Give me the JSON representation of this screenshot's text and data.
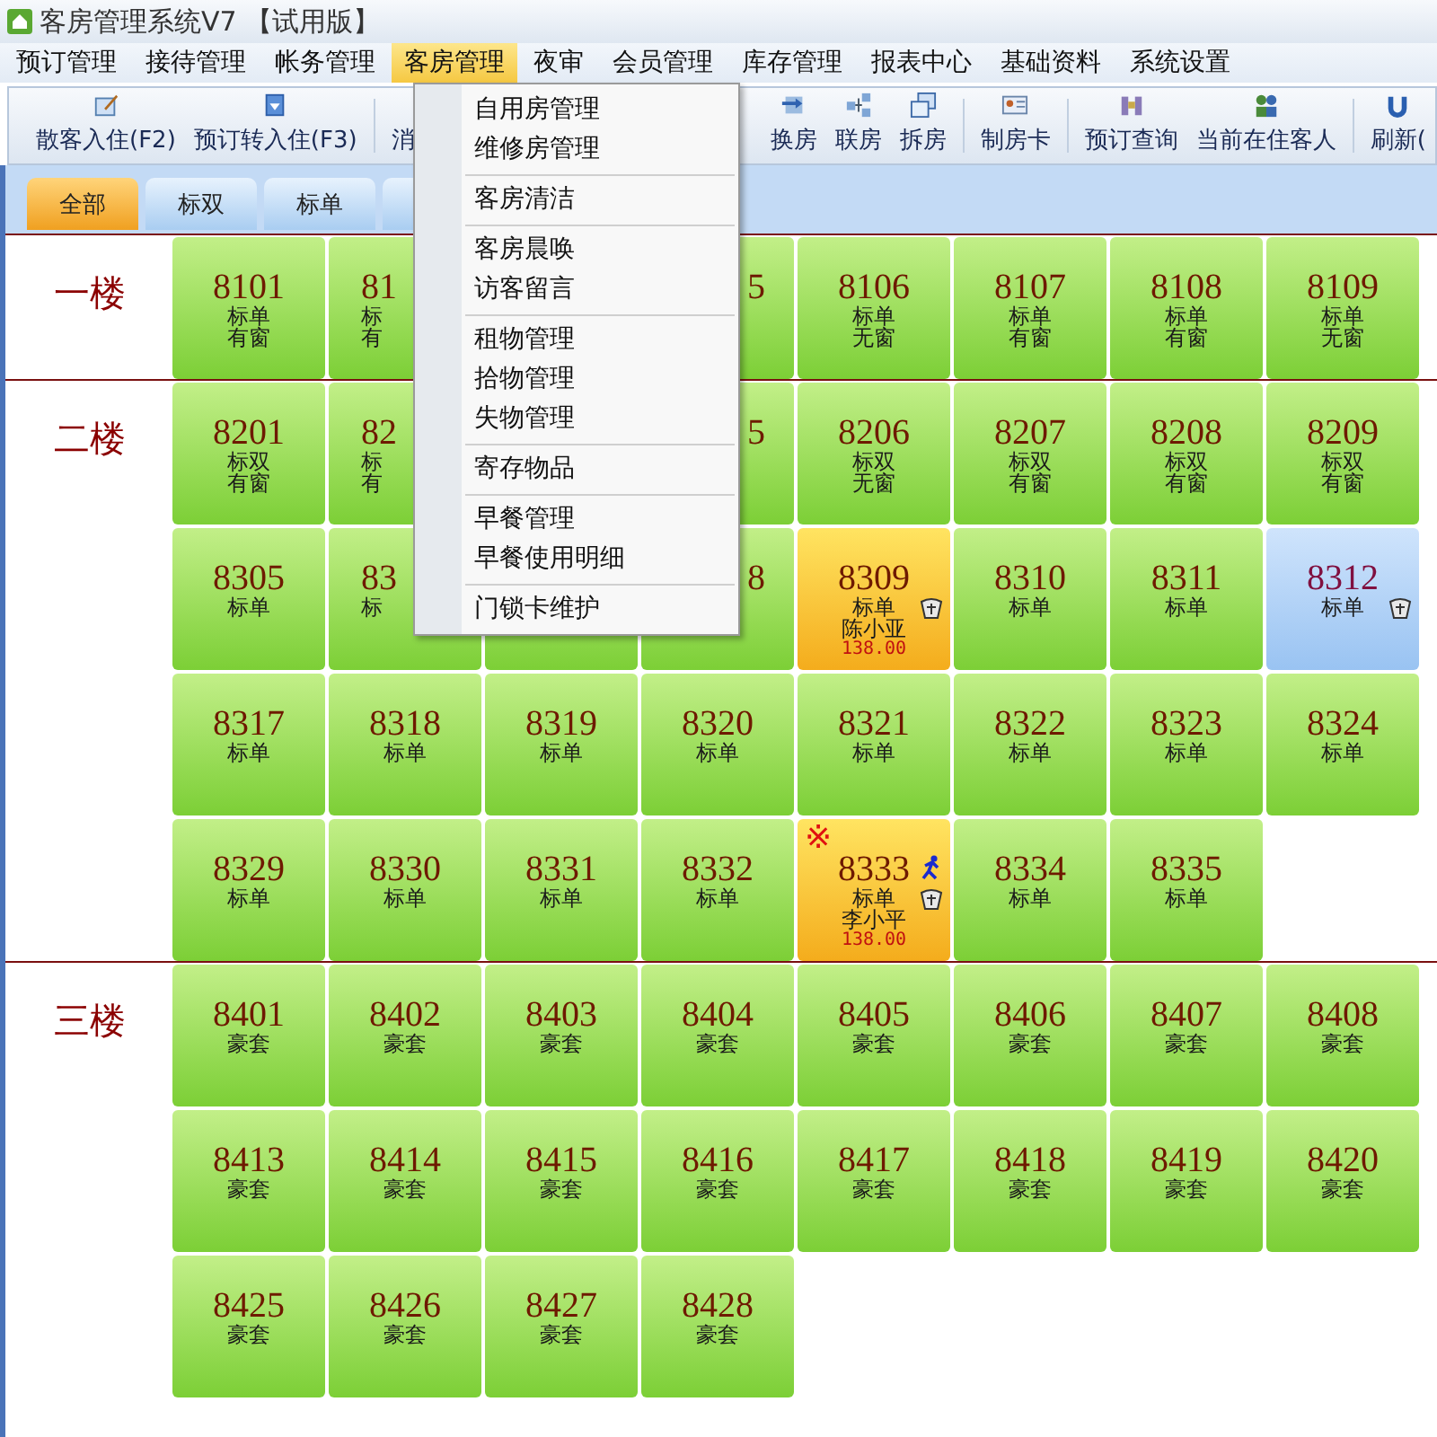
{
  "window": {
    "title": "客房管理系统V7 【试用版】"
  },
  "menu_bar": [
    {
      "label": "预订管理",
      "selected": false
    },
    {
      "label": "接待管理",
      "selected": false
    },
    {
      "label": "帐务管理",
      "selected": false
    },
    {
      "label": "客房管理",
      "selected": true
    },
    {
      "label": "夜审",
      "selected": false
    },
    {
      "label": "会员管理",
      "selected": false
    },
    {
      "label": "库存管理",
      "selected": false
    },
    {
      "label": "报表中心",
      "selected": false
    },
    {
      "label": "基础资料",
      "selected": false
    },
    {
      "label": "系统设置",
      "selected": false
    }
  ],
  "toolbar": {
    "left": [
      {
        "kind": "button",
        "label": "散客入住(F2)"
      },
      {
        "kind": "button",
        "label": "预订转入住(F3)"
      },
      {
        "kind": "separator"
      },
      {
        "kind": "button",
        "label": "消"
      }
    ],
    "right": [
      {
        "kind": "button",
        "label": "换房"
      },
      {
        "kind": "button",
        "label": "联房"
      },
      {
        "kind": "button",
        "label": "拆房"
      },
      {
        "kind": "separator"
      },
      {
        "kind": "button",
        "label": "制房卡"
      },
      {
        "kind": "separator"
      },
      {
        "kind": "button",
        "label": "预订查询"
      },
      {
        "kind": "button",
        "label": "当前在住客人"
      },
      {
        "kind": "separator"
      },
      {
        "kind": "button",
        "label": "刷新("
      }
    ]
  },
  "tabs": [
    {
      "label": "全部",
      "selected": true
    },
    {
      "label": "标双",
      "selected": false
    },
    {
      "label": "标单",
      "selected": false
    },
    {
      "selected": false
    }
  ],
  "floors": [
    {
      "label": "一楼",
      "rows": [
        [
          {
            "kind": "room",
            "number": "8101",
            "type": "标单",
            "note": "有窗",
            "occupied": false,
            "reserved": false,
            "cup": false,
            "walking": false
          },
          {
            "kind": "leftpart",
            "number": "81",
            "type": "标",
            "note": "有",
            "occupied": false,
            "reserved": false,
            "cup": false,
            "walking": false
          },
          {
            "kind": "covered"
          },
          {
            "kind": "rightpart",
            "number": "5",
            "occupied": false,
            "reserved": false,
            "cup": false,
            "walking": false
          },
          {
            "kind": "room",
            "number": "8106",
            "type": "标单",
            "note": "无窗",
            "occupied": false,
            "reserved": false,
            "cup": false,
            "walking": false
          },
          {
            "kind": "room",
            "number": "8107",
            "type": "标单",
            "note": "有窗",
            "occupied": false,
            "reserved": false,
            "cup": false,
            "walking": false
          },
          {
            "kind": "room",
            "number": "8108",
            "type": "标单",
            "note": "有窗",
            "occupied": false,
            "reserved": false,
            "cup": false,
            "walking": false
          },
          {
            "kind": "room",
            "number": "8109",
            "type": "标单",
            "note": "无窗",
            "occupied": false,
            "reserved": false,
            "cup": false,
            "walking": false
          }
        ]
      ]
    },
    {
      "label": "二楼",
      "rows": [
        [
          {
            "kind": "room",
            "number": "8201",
            "type": "标双",
            "note": "有窗",
            "occupied": false,
            "reserved": false,
            "cup": false,
            "walking": false
          },
          {
            "kind": "leftpart",
            "number": "82",
            "type": "标",
            "note": "有",
            "occupied": false,
            "reserved": false,
            "cup": false,
            "walking": false
          },
          {
            "kind": "covered"
          },
          {
            "kind": "rightpart",
            "number": "5",
            "occupied": false,
            "reserved": false,
            "cup": false,
            "walking": false
          },
          {
            "kind": "room",
            "number": "8206",
            "type": "标双",
            "note": "无窗",
            "occupied": false,
            "reserved": false,
            "cup": false,
            "walking": false
          },
          {
            "kind": "room",
            "number": "8207",
            "type": "标双",
            "note": "有窗",
            "occupied": false,
            "reserved": false,
            "cup": false,
            "walking": false
          },
          {
            "kind": "room",
            "number": "8208",
            "type": "标双",
            "note": "有窗",
            "occupied": false,
            "reserved": false,
            "cup": false,
            "walking": false
          },
          {
            "kind": "room",
            "number": "8209",
            "type": "标双",
            "note": "有窗",
            "occupied": false,
            "reserved": false,
            "cup": false,
            "walking": false
          }
        ],
        [
          {
            "kind": "room",
            "number": "8305",
            "type": "标单",
            "occupied": false,
            "reserved": false,
            "cup": false,
            "walking": false
          },
          {
            "kind": "leftpart",
            "number": "83",
            "type": "标",
            "occupied": false,
            "reserved": false,
            "cup": false,
            "walking": false
          },
          {
            "kind": "room",
            "occupied": false,
            "reserved": false,
            "cup": false,
            "walking": false
          },
          {
            "kind": "rightpart",
            "number": "8",
            "occupied": false,
            "reserved": false,
            "cup": false,
            "walking": false
          },
          {
            "kind": "room",
            "number": "8309",
            "type": "标单",
            "guest": "陈小亚",
            "price": "138.00",
            "occupied": true,
            "reserved": false,
            "cup": true,
            "walking": false
          },
          {
            "kind": "room",
            "number": "8310",
            "type": "标单",
            "occupied": false,
            "reserved": false,
            "cup": false,
            "walking": false
          },
          {
            "kind": "room",
            "number": "8311",
            "type": "标单",
            "occupied": false,
            "reserved": false,
            "cup": false,
            "walking": false
          },
          {
            "kind": "room",
            "number": "8312",
            "type": "标单",
            "occupied": false,
            "reserved": true,
            "cup": true,
            "walking": false
          }
        ],
        [
          {
            "kind": "room",
            "number": "8317",
            "type": "标单",
            "occupied": false,
            "reserved": false,
            "cup": false,
            "walking": false
          },
          {
            "kind": "room",
            "number": "8318",
            "type": "标单",
            "occupied": false,
            "reserved": false,
            "cup": false,
            "walking": false
          },
          {
            "kind": "room",
            "number": "8319",
            "type": "标单",
            "occupied": false,
            "reserved": false,
            "cup": false,
            "walking": false
          },
          {
            "kind": "room",
            "number": "8320",
            "type": "标单",
            "occupied": false,
            "reserved": false,
            "cup": false,
            "walking": false
          },
          {
            "kind": "room",
            "number": "8321",
            "type": "标单",
            "occupied": false,
            "reserved": false,
            "cup": false,
            "walking": false
          },
          {
            "kind": "room",
            "number": "8322",
            "type": "标单",
            "occupied": false,
            "reserved": false,
            "cup": false,
            "walking": false
          },
          {
            "kind": "room",
            "number": "8323",
            "type": "标单",
            "occupied": false,
            "reserved": false,
            "cup": false,
            "walking": false
          },
          {
            "kind": "room",
            "number": "8324",
            "type": "标单",
            "occupied": false,
            "reserved": false,
            "cup": false,
            "walking": false
          }
        ],
        [
          {
            "kind": "room",
            "number": "8329",
            "type": "标单",
            "occupied": false,
            "reserved": false,
            "cup": false,
            "walking": false
          },
          {
            "kind": "room",
            "number": "8330",
            "type": "标单",
            "occupied": false,
            "reserved": false,
            "cup": false,
            "walking": false
          },
          {
            "kind": "room",
            "number": "8331",
            "type": "标单",
            "occupied": false,
            "reserved": false,
            "cup": false,
            "walking": false
          },
          {
            "kind": "room",
            "number": "8332",
            "type": "标单",
            "occupied": false,
            "reserved": false,
            "cup": false,
            "walking": false
          },
          {
            "kind": "room",
            "number": "8333",
            "type": "标单",
            "guest": "李小平",
            "price": "138.00",
            "occupied": true,
            "reserved": false,
            "mark": "※",
            "cup": true,
            "walking": true
          },
          {
            "kind": "room",
            "number": "8334",
            "type": "标单",
            "occupied": false,
            "reserved": false,
            "cup": false,
            "walking": false
          },
          {
            "kind": "room",
            "number": "8335",
            "type": "标单",
            "occupied": false,
            "reserved": false,
            "cup": false,
            "walking": false
          }
        ]
      ]
    },
    {
      "label": "三楼",
      "rows": [
        [
          {
            "kind": "room",
            "number": "8401",
            "type": "豪套",
            "occupied": false,
            "reserved": false,
            "cup": false,
            "walking": false
          },
          {
            "kind": "room",
            "number": "8402",
            "type": "豪套",
            "occupied": false,
            "reserved": false,
            "cup": false,
            "walking": false
          },
          {
            "kind": "room",
            "number": "8403",
            "type": "豪套",
            "occupied": false,
            "reserved": false,
            "cup": false,
            "walking": false
          },
          {
            "kind": "room",
            "number": "8404",
            "type": "豪套",
            "occupied": false,
            "reserved": false,
            "cup": false,
            "walking": false
          },
          {
            "kind": "room",
            "number": "8405",
            "type": "豪套",
            "occupied": false,
            "reserved": false,
            "cup": false,
            "walking": false
          },
          {
            "kind": "room",
            "number": "8406",
            "type": "豪套",
            "occupied": false,
            "reserved": false,
            "cup": false,
            "walking": false
          },
          {
            "kind": "room",
            "number": "8407",
            "type": "豪套",
            "occupied": false,
            "reserved": false,
            "cup": false,
            "walking": false
          },
          {
            "kind": "room",
            "number": "8408",
            "type": "豪套",
            "occupied": false,
            "reserved": false,
            "cup": false,
            "walking": false
          }
        ],
        [
          {
            "kind": "room",
            "number": "8413",
            "type": "豪套",
            "occupied": false,
            "reserved": false,
            "cup": false,
            "walking": false
          },
          {
            "kind": "room",
            "number": "8414",
            "type": "豪套",
            "occupied": false,
            "reserved": false,
            "cup": false,
            "walking": false
          },
          {
            "kind": "room",
            "number": "8415",
            "type": "豪套",
            "occupied": false,
            "reserved": false,
            "cup": false,
            "walking": false
          },
          {
            "kind": "room",
            "number": "8416",
            "type": "豪套",
            "occupied": false,
            "reserved": false,
            "cup": false,
            "walking": false
          },
          {
            "kind": "room",
            "number": "8417",
            "type": "豪套",
            "occupied": false,
            "reserved": false,
            "cup": false,
            "walking": false
          },
          {
            "kind": "room",
            "number": "8418",
            "type": "豪套",
            "occupied": false,
            "reserved": false,
            "cup": false,
            "walking": false
          },
          {
            "kind": "room",
            "number": "8419",
            "type": "豪套",
            "occupied": false,
            "reserved": false,
            "cup": false,
            "walking": false
          },
          {
            "kind": "room",
            "number": "8420",
            "type": "豪套",
            "occupied": false,
            "reserved": false,
            "cup": false,
            "walking": false
          }
        ],
        [
          {
            "kind": "room",
            "number": "8425",
            "type": "豪套",
            "occupied": false,
            "reserved": false,
            "cup": false,
            "walking": false
          },
          {
            "kind": "room",
            "number": "8426",
            "type": "豪套",
            "occupied": false,
            "reserved": false,
            "cup": false,
            "walking": false
          },
          {
            "kind": "room",
            "number": "8427",
            "type": "豪套",
            "occupied": false,
            "reserved": false,
            "cup": false,
            "walking": false
          },
          {
            "kind": "room",
            "number": "8428",
            "type": "豪套",
            "occupied": false,
            "reserved": false,
            "cup": false,
            "walking": false
          }
        ]
      ]
    }
  ],
  "dropdown_menu": {
    "groups": [
      [
        "自用房管理",
        "维修房管理"
      ],
      [
        "客房清洁"
      ],
      [
        "客房晨唤",
        "访客留言"
      ],
      [
        "租物管理",
        "拾物管理",
        "失物管理"
      ],
      [
        "寄存物品"
      ],
      [
        "早餐管理",
        "早餐使用明细"
      ],
      [
        "门锁卡维护"
      ]
    ]
  }
}
